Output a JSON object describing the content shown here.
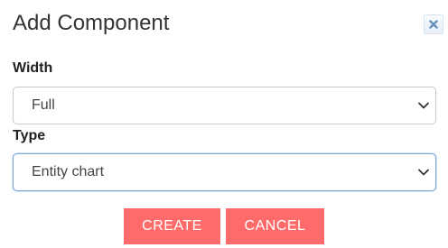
{
  "dialog": {
    "title": "Add Component",
    "close_icon": "close-x-icon"
  },
  "fields": {
    "width": {
      "label": "Width",
      "selected": "Full"
    },
    "type": {
      "label": "Type",
      "selected": "Entity chart"
    }
  },
  "actions": {
    "create_label": "CREATE",
    "cancel_label": "CANCEL"
  },
  "colors": {
    "button_bg": "#ff6b6b",
    "button_text": "#ffffff",
    "focus_border": "#7aa6d8",
    "close_icon": "#6a8fbf"
  }
}
